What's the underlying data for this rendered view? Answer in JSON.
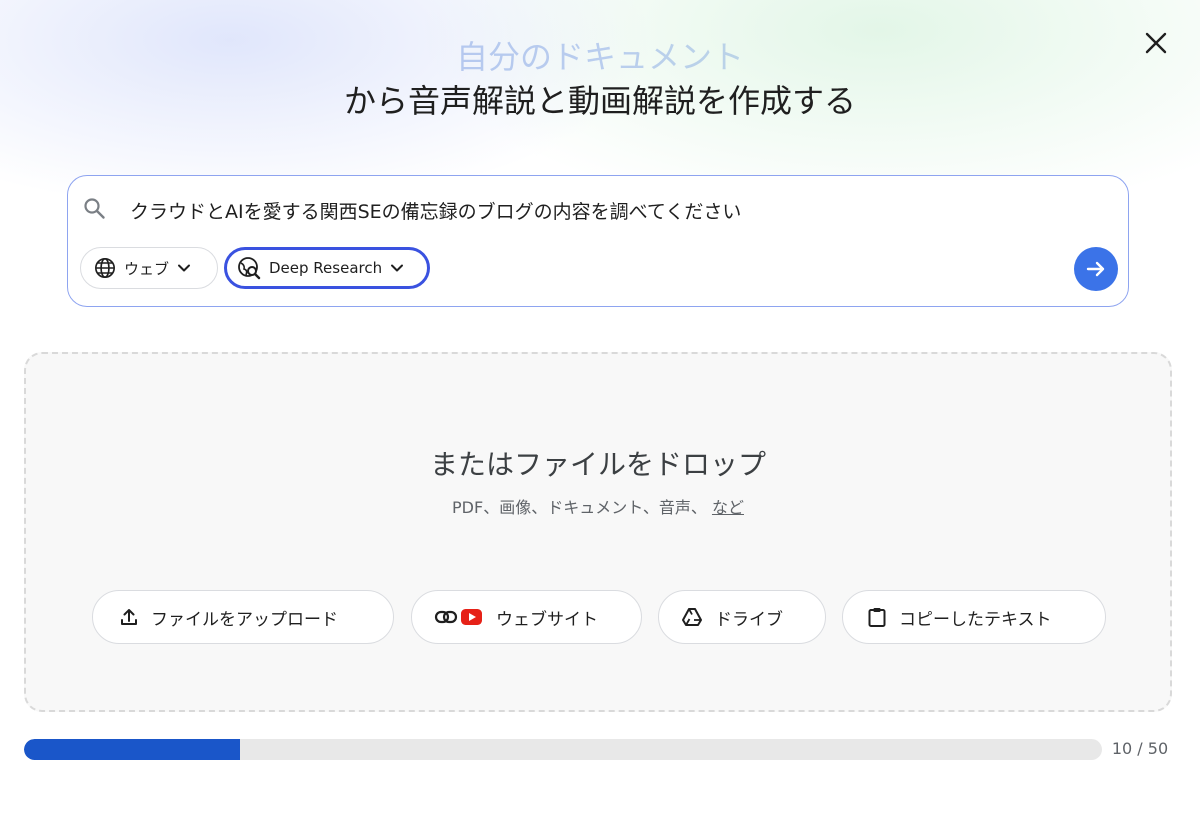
{
  "dialog": {
    "title_line1": "自分のドキュメント",
    "title_line2": "から音声解説と動画解説を作成する",
    "close_icon": "close-icon"
  },
  "search": {
    "value": "クラウドとAIを愛する関西SEの備忘録のブログの内容を調べてください",
    "icon": "search-icon",
    "source_chip": {
      "label": "ウェブ",
      "icon": "globe-icon"
    },
    "mode_chip": {
      "label": "Deep Research",
      "icon": "deep-research-icon"
    },
    "send_icon": "arrow-right-icon",
    "colors": {
      "accent": "#3b73e8",
      "focus_border": "#3a52e0"
    }
  },
  "drop_zone": {
    "title": "またはファイルをドロップ",
    "subtitle": "PDF、画像、ドキュメント、音声、",
    "more_link": "など",
    "buttons": [
      {
        "label": "ファイルをアップロード",
        "icon": "upload-icon"
      },
      {
        "label": "ウェブサイト",
        "icon": "link-youtube-icon"
      },
      {
        "label": "ドライブ",
        "icon": "drive-icon"
      },
      {
        "label": "コピーしたテキスト",
        "icon": "clipboard-icon"
      }
    ]
  },
  "progress": {
    "current": 10,
    "max": 50,
    "label": "10 / 50",
    "color": "#1a56c9"
  }
}
